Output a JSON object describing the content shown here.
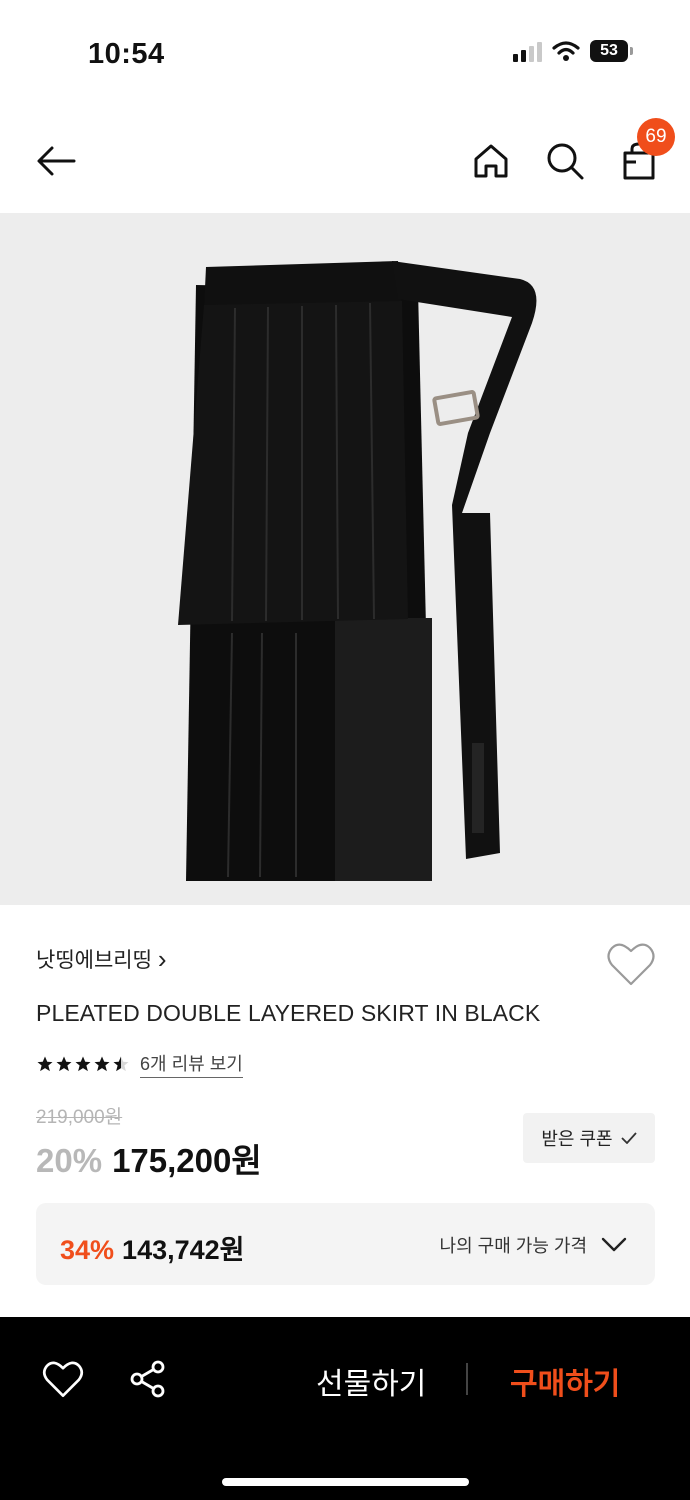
{
  "status_bar": {
    "time": "10:54",
    "battery": "53"
  },
  "nav": {
    "cart_count": "69"
  },
  "product": {
    "brand": "낫띵에브리띵",
    "brand_chevron": "›",
    "title": "PLEATED DOUBLE LAYERED SKIRT IN BLACK",
    "rating": 4.5,
    "review_link": "6개 리뷰 보기",
    "original_price": "219,000원",
    "discount_rate": "20%",
    "sale_price": "175,200원",
    "coupon_button": "받은 쿠폰",
    "my_price": {
      "discount_rate": "34%",
      "price": "143,742원",
      "label": "나의 구매 가능 가격"
    }
  },
  "bottom_bar": {
    "gift_label": "선물하기",
    "buy_label": "구매하기"
  },
  "icons": [
    "back-arrow-icon",
    "home-icon",
    "search-icon",
    "shopping-bag-icon",
    "heart-icon",
    "share-icon",
    "star-icon",
    "chevron-down-icon",
    "check-icon"
  ],
  "colors": {
    "accent": "#f04e1b",
    "bottom_bar": "#000000",
    "price_box": "#f4f4f4"
  }
}
